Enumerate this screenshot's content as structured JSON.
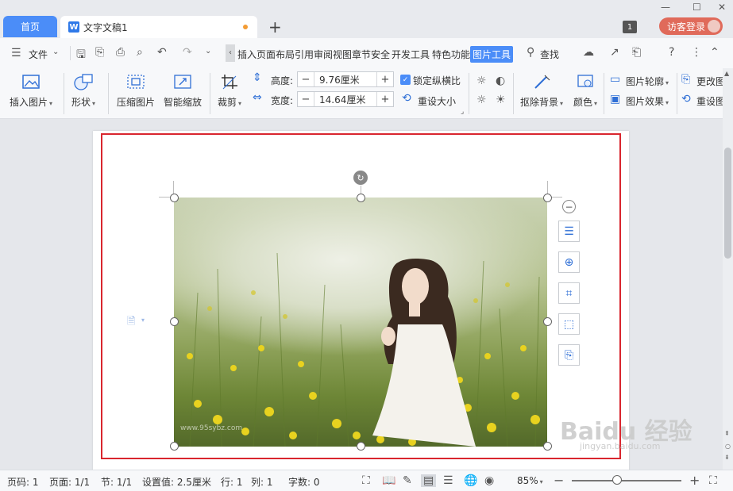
{
  "titlebar": {
    "home_tab": "首页",
    "doc_tab": "文字文稿1",
    "new_tab": "+",
    "window_count": "1",
    "login": "访客登录"
  },
  "menubar": {
    "file": "文件",
    "items": [
      "插入",
      "页面布局",
      "引用",
      "审阅",
      "视图",
      "章节",
      "安全",
      "开发工具",
      "特色功能"
    ],
    "active": "图片工具",
    "search": "查找"
  },
  "ribbon": {
    "insert_picture": "插入图片",
    "shape": "形状",
    "compress": "压缩图片",
    "smart_scale": "智能缩放",
    "crop": "裁剪",
    "height_label": "高度:",
    "height_value": "9.76厘米",
    "width_label": "宽度:",
    "width_value": "14.64厘米",
    "lock_ratio": "锁定纵横比",
    "reset_size": "重设大小",
    "remove_bg": "抠除背景",
    "color": "颜色",
    "outline": "图片轮廓",
    "effect": "图片效果",
    "change_pic": "更改图",
    "reset_pic": "重设图"
  },
  "photo": {
    "watermark": "www.95sybz.com"
  },
  "statusbar": {
    "page_label": "页码: 1",
    "pages": "页面: 1/1",
    "section": "节: 1/1",
    "setting": "设置值: 2.5厘米",
    "row": "行: 1",
    "col": "列: 1",
    "words": "字数: 0",
    "zoom": "85%"
  },
  "watermark": {
    "brand": "Baidu 经验",
    "url": "jingyan.baidu.com"
  }
}
